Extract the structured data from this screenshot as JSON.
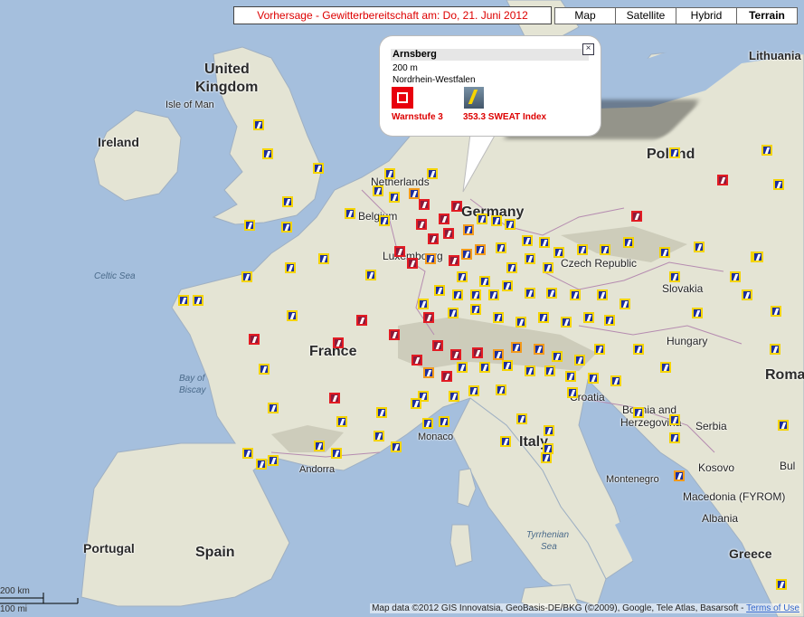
{
  "title": "Vorhersage - Gewitterbereitschaft am: Do, 21. Juni 2012",
  "map_types": [
    {
      "label": "Map",
      "active": false
    },
    {
      "label": "Satellite",
      "active": false
    },
    {
      "label": "Hybrid",
      "active": false
    },
    {
      "label": "Terrain",
      "active": true
    }
  ],
  "popup": {
    "name": "Arnsberg",
    "elevation": "200 m",
    "state": "Nordrhein-Westfalen",
    "warning_label": "Warnstufe 3",
    "sweat_label": "353.3  SWEAT Index",
    "close_symbol": "×"
  },
  "labels": {
    "countries": [
      "United",
      "Kingdom",
      "Ireland",
      "Poland",
      "France",
      "Italy",
      "Spain",
      "Portugal",
      "Greece",
      "Lithuania",
      "Roma",
      "Germany",
      "Netherlands"
    ],
    "regions": [
      "Isle of Man",
      "Belgium",
      "Luxembourg",
      "Czech Republic",
      "Slovakia",
      "Hungary",
      "Croatia",
      "Bosnia and",
      "Herzegovina",
      "Serbia",
      "Kosovo",
      "Montenegro",
      "Macedonia (FYROM)",
      "Albania",
      "Andorra",
      "Monaco",
      "Bul"
    ],
    "seas": [
      "Celtic Sea",
      "Bay of",
      "Biscay",
      "Tyrrhenian",
      "Sea"
    ]
  },
  "icon_legend": {
    "yellow_border": "#f5d400",
    "orange_border": "#f39a1a",
    "red_border": "#e31b23"
  },
  "scale": {
    "km": "200 km",
    "mi": "100 mi"
  },
  "attribution": "Map data ©2012 GIS Innovatsia, GeoBasis-DE/BKG (©2009), Google, Tele Atlas, Basarsoft - ",
  "terms_link": "Terms of Use"
}
